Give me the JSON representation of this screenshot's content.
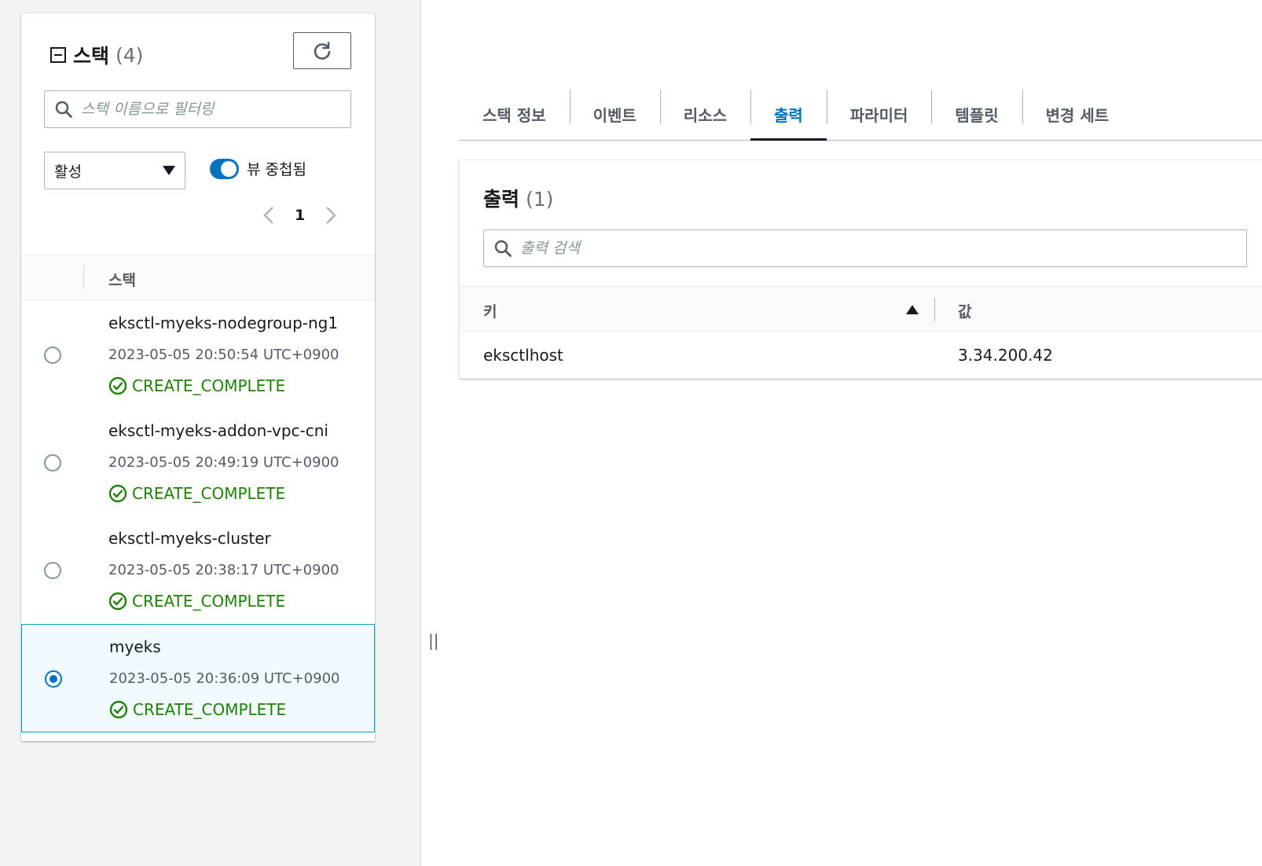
{
  "colors": {
    "accent": "#0073bb",
    "success": "#1d8102",
    "selected_row_bg": "#f1faff"
  },
  "stacks_panel": {
    "title": "스택",
    "count": "(4)",
    "filter_placeholder": "스택 이름으로 필터링",
    "status_filter": "활성",
    "nested_toggle_label": "뷰 중첩됨",
    "nested_toggle_on": true,
    "page": "1",
    "column_header": "스택",
    "stacks": [
      {
        "name": "eksctl-myeks-nodegroup-ng1",
        "created": "2023-05-05 20:50:54 UTC+0900",
        "status": "CREATE_COMPLETE",
        "selected": false
      },
      {
        "name": "eksctl-myeks-addon-vpc-cni",
        "created": "2023-05-05 20:49:19 UTC+0900",
        "status": "CREATE_COMPLETE",
        "selected": false
      },
      {
        "name": "eksctl-myeks-cluster",
        "created": "2023-05-05 20:38:17 UTC+0900",
        "status": "CREATE_COMPLETE",
        "selected": false
      },
      {
        "name": "myeks",
        "created": "2023-05-05 20:36:09 UTC+0900",
        "status": "CREATE_COMPLETE",
        "selected": true
      }
    ]
  },
  "detail_tabs": [
    {
      "label": "스택 정보",
      "active": false
    },
    {
      "label": "이벤트",
      "active": false
    },
    {
      "label": "리소스",
      "active": false
    },
    {
      "label": "출력",
      "active": true
    },
    {
      "label": "파라미터",
      "active": false
    },
    {
      "label": "템플릿",
      "active": false
    },
    {
      "label": "변경 세트",
      "active": false
    }
  ],
  "outputs": {
    "title": "출력",
    "count": "(1)",
    "search_placeholder": "출력 검색",
    "key_header": "키",
    "value_header": "값",
    "rows": [
      {
        "key": "eksctlhost",
        "value": "3.34.200.42"
      }
    ]
  }
}
